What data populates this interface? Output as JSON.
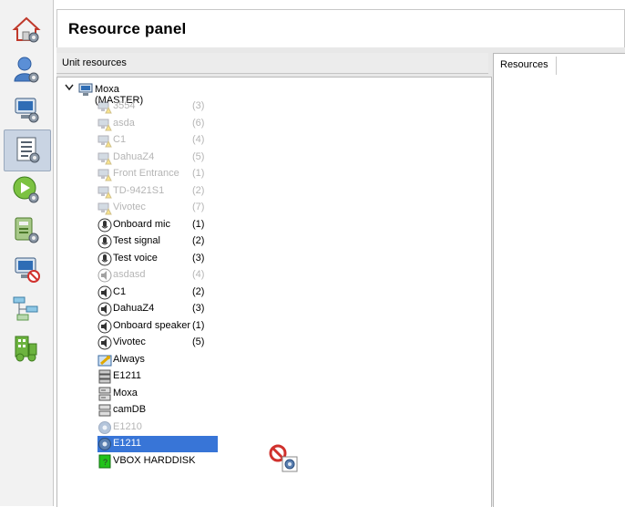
{
  "header": {
    "title": "Resource panel"
  },
  "sidebar": {
    "items": [
      {
        "name": "home-settings-icon"
      },
      {
        "name": "user-settings-icon"
      },
      {
        "name": "camera-settings-icon"
      },
      {
        "name": "resource-panel-icon",
        "active": true
      },
      {
        "name": "play-settings-icon"
      },
      {
        "name": "device-settings-icon"
      },
      {
        "name": "camera-blocked-icon"
      },
      {
        "name": "network-tree-icon"
      },
      {
        "name": "building-icon"
      }
    ]
  },
  "unit_panel": {
    "title": "Unit resources",
    "root": {
      "label": "Moxa (MASTER)"
    },
    "items": [
      {
        "label": "3554",
        "count": "(3)",
        "icon": "camera-warning-icon",
        "disabled": true
      },
      {
        "label": "asda",
        "count": "(6)",
        "icon": "camera-warning-icon",
        "disabled": true
      },
      {
        "label": "C1",
        "count": "(4)",
        "icon": "camera-warning-icon",
        "disabled": true
      },
      {
        "label": "DahuaZ4",
        "count": "(5)",
        "icon": "camera-warning-icon",
        "disabled": true
      },
      {
        "label": "Front Entrance",
        "count": "(1)",
        "icon": "camera-warning-icon",
        "disabled": true
      },
      {
        "label": "TD-9421S1",
        "count": "(2)",
        "icon": "camera-warning-icon",
        "disabled": true
      },
      {
        "label": "Vivotec",
        "count": "(7)",
        "icon": "camera-warning-icon",
        "disabled": true
      },
      {
        "label": "Onboard mic",
        "count": "(1)",
        "icon": "microphone-icon",
        "disabled": false
      },
      {
        "label": "Test signal",
        "count": "(2)",
        "icon": "microphone-icon",
        "disabled": false
      },
      {
        "label": "Test voice",
        "count": "(3)",
        "icon": "microphone-icon",
        "disabled": false
      },
      {
        "label": "asdasd",
        "count": "(4)",
        "icon": "speaker-icon",
        "disabled": true
      },
      {
        "label": "C1",
        "count": "(2)",
        "icon": "speaker-icon",
        "disabled": false
      },
      {
        "label": "DahuaZ4",
        "count": "(3)",
        "icon": "speaker-icon",
        "disabled": false
      },
      {
        "label": "Onboard speaker",
        "count": "(1)",
        "icon": "speaker-icon",
        "disabled": false
      },
      {
        "label": "Vivotec",
        "count": "(5)",
        "icon": "speaker-icon",
        "disabled": false
      },
      {
        "label": "Always",
        "count": "",
        "icon": "schedule-icon",
        "disabled": false
      },
      {
        "label": "E1211",
        "count": "",
        "icon": "io-device-icon",
        "disabled": false
      },
      {
        "label": "Moxa",
        "count": "",
        "icon": "server-icon",
        "disabled": false
      },
      {
        "label": "camDB",
        "count": "",
        "icon": "database-icon",
        "disabled": false
      },
      {
        "label": "E1210",
        "count": "",
        "icon": "gear-icon",
        "disabled": true
      },
      {
        "label": "E1211",
        "count": "",
        "icon": "gear-icon",
        "disabled": false,
        "selected": true
      },
      {
        "label": "VBOX HARDDISK",
        "count": "",
        "icon": "disk-icon",
        "disabled": false
      }
    ]
  },
  "resources_panel": {
    "tab_label": "Resources"
  },
  "colors": {
    "selection": "#3875d7",
    "disabled_text": "#b5b5b5",
    "panel_border": "#b8b8b8"
  }
}
